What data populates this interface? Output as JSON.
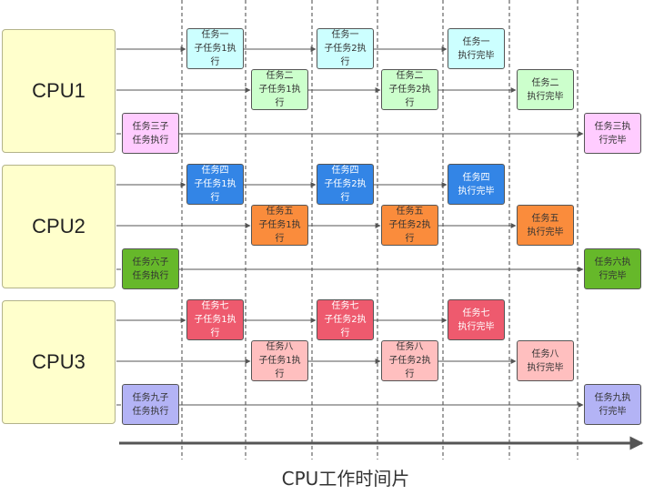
{
  "caption": "CPU工作时间片",
  "colors": {
    "line": "#555555",
    "grid": "#444444",
    "cpu_fill": "#ffffcc"
  },
  "cpus": [
    {
      "label": "CPU1",
      "rows": [
        {
          "color": "#ccffff",
          "dark": false,
          "boxes": [
            {
              "col": 1,
              "text": "任务一\n子任务1执\n行"
            },
            {
              "col": 3,
              "text": "任务一\n子任务2执\n行"
            },
            {
              "col": 5,
              "text": "任务一\n执行完毕"
            }
          ]
        },
        {
          "color": "#ccffcc",
          "dark": false,
          "boxes": [
            {
              "col": 2,
              "text": "任务二\n子任务1执\n行"
            },
            {
              "col": 4,
              "text": "任务二\n子任务2执\n行"
            },
            {
              "col": 6,
              "text": "任务二\n执行完毕"
            }
          ]
        },
        {
          "color": "#ffccff",
          "dark": false,
          "boxes": [
            {
              "col": 0,
              "text": "任务三子\n任务执行"
            },
            {
              "col": 7,
              "text": "任务三执\n行完毕"
            }
          ]
        }
      ]
    },
    {
      "label": "CPU2",
      "rows": [
        {
          "color": "#3385e6",
          "dark": true,
          "boxes": [
            {
              "col": 1,
              "text": "任务四\n子任务1执\n行"
            },
            {
              "col": 3,
              "text": "任务四\n子任务2执\n行"
            },
            {
              "col": 5,
              "text": "任务四\n执行完毕"
            }
          ]
        },
        {
          "color": "#fa8c3c",
          "dark": false,
          "boxes": [
            {
              "col": 2,
              "text": "任务五\n子任务1执\n行"
            },
            {
              "col": 4,
              "text": "任务五\n子任务2执\n行"
            },
            {
              "col": 6,
              "text": "任务五\n执行完毕"
            }
          ]
        },
        {
          "color": "#66b82a",
          "dark": false,
          "boxes": [
            {
              "col": 0,
              "text": "任务六子\n任务执行"
            },
            {
              "col": 7,
              "text": "任务六执\n行完毕"
            }
          ]
        }
      ]
    },
    {
      "label": "CPU3",
      "rows": [
        {
          "color": "#ee5a6e",
          "dark": true,
          "boxes": [
            {
              "col": 1,
              "text": "任务七\n子任务1执\n行"
            },
            {
              "col": 3,
              "text": "任务七\n子任务2执\n行"
            },
            {
              "col": 5,
              "text": "任务七\n执行完毕"
            }
          ]
        },
        {
          "color": "#ffbfbf",
          "dark": false,
          "boxes": [
            {
              "col": 2,
              "text": "任务八\n子任务1执\n行"
            },
            {
              "col": 4,
              "text": "任务八\n子任务2执\n行"
            },
            {
              "col": 6,
              "text": "任务八\n执行完毕"
            }
          ]
        },
        {
          "color": "#b3b3f5",
          "dark": false,
          "boxes": [
            {
              "col": 0,
              "text": "任务九子\n任务执行"
            },
            {
              "col": 7,
              "text": "任务九执\n行完毕"
            }
          ]
        }
      ]
    }
  ]
}
